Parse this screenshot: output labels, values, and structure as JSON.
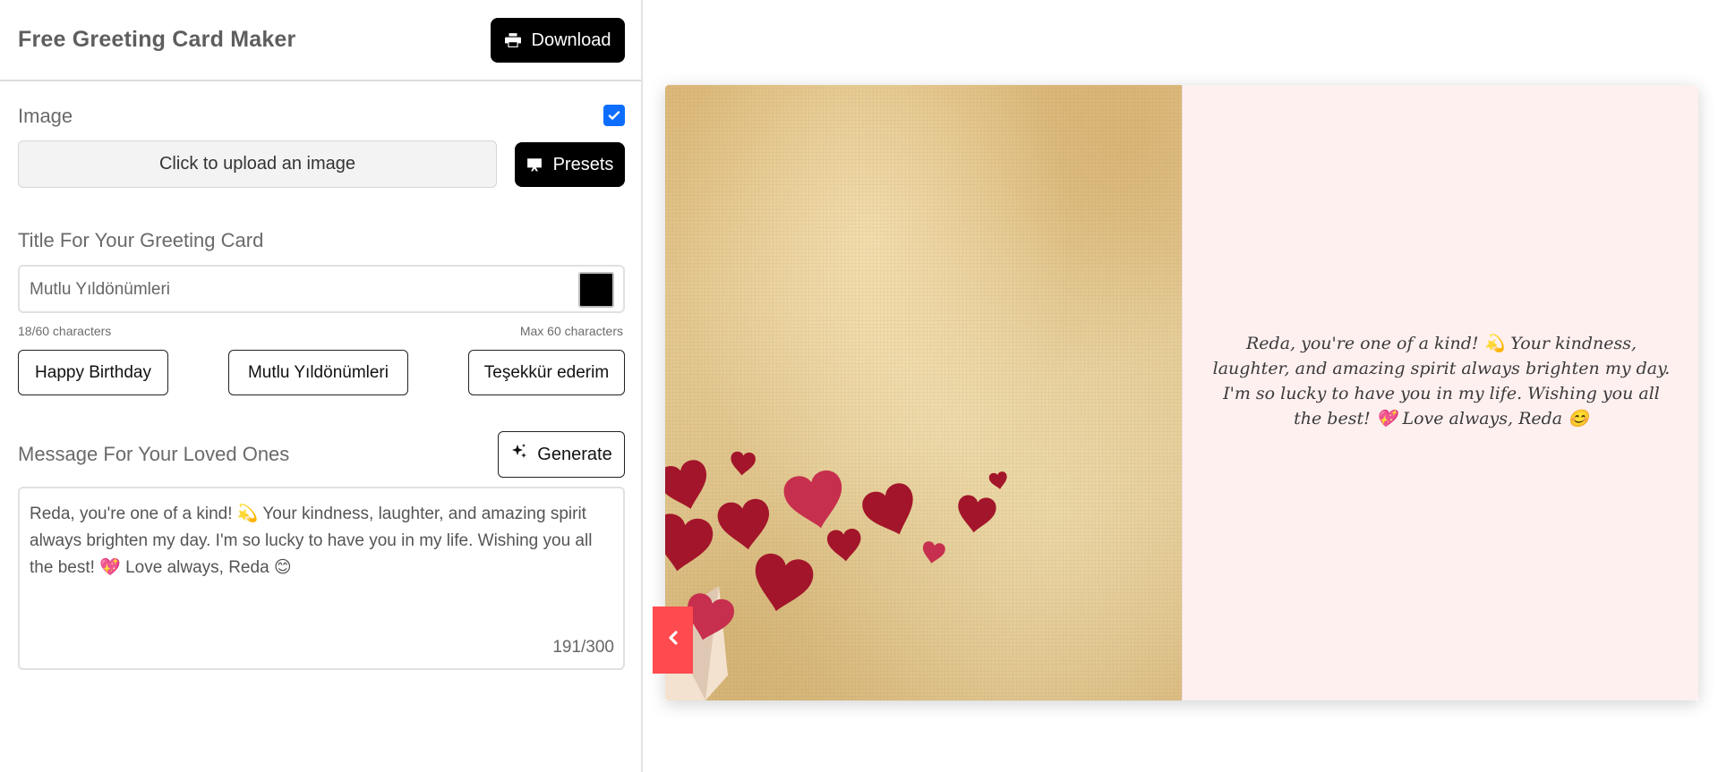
{
  "app": {
    "title": "Free Greeting Card Maker"
  },
  "toolbar": {
    "download_label": "Download"
  },
  "image_section": {
    "label": "Image",
    "enabled": true,
    "upload_label": "Click to upload an image",
    "presets_label": "Presets"
  },
  "title_section": {
    "label": "Title For Your Greeting Card",
    "value": "Mutlu Yıldönümleri",
    "color": "#000000",
    "char_count": "18/60 characters",
    "max_hint": "Max 60 characters",
    "presets": [
      "Happy Birthday",
      "Mutlu Yıldönümleri",
      "Teşekkür ederim"
    ]
  },
  "message_section": {
    "label": "Message For Your Loved Ones",
    "generate_label": "Generate",
    "value": "Reda, you're one of a kind! 💫  Your kindness, laughter, and amazing spirit always brighten my day.  I'm so lucky to have you in my life.  Wishing you all the best! 💖  Love always, Reda 😊",
    "char_count": "191/300"
  },
  "card": {
    "inside_message": "Reda, you're one of a kind! 💫 Your kindness, laughter, and amazing spirit always brighten my day. I'm so lucky to have you in my life. Wishing you all the best! 💖 Love always, Reda 😊",
    "inside_background": "#fff0f0",
    "nav_color": "#ff4a4f",
    "front_image": "hearts-on-parchment"
  },
  "icons": {
    "download": "printer-icon",
    "presets": "presentation-icon",
    "generate": "sparkles-icon",
    "nav": "chevron-left-icon"
  }
}
